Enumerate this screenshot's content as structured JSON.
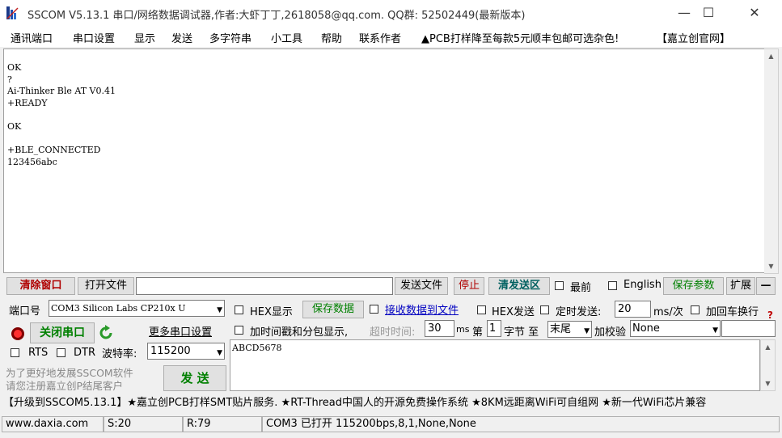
{
  "window": {
    "title": "SSCOM V5.13.1 串口/网络数据调试器,作者:大虾丁丁,2618058@qq.com. QQ群: 52502449(最新版本)",
    "minimize": "—",
    "maximize": "☐",
    "close": "✕"
  },
  "menu": [
    "通讯端口",
    "串口设置",
    "显示",
    "发送",
    "多字符串",
    "小工具",
    "帮助",
    "联系作者",
    "▲PCB打样降至每款5元顺丰包邮可选杂色!",
    "【嘉立创官网】"
  ],
  "receive": {
    "lines": [
      "OK",
      "?",
      "Ai-Thinker Ble AT V0.41",
      "+READY",
      "",
      "OK",
      "",
      "+BLE_CONNECTED",
      "123456abc"
    ]
  },
  "row1": {
    "clear_window": "清除窗口",
    "open_file": "打开文件",
    "file_path": "",
    "send_file": "发送文件",
    "stop": "停止",
    "clear_send": "清发送区",
    "last_checkbox": "最前",
    "english_checkbox": "English",
    "save_params": "保存参数",
    "expand": "扩展",
    "collapse": "—"
  },
  "port": {
    "port_label": "端口号",
    "port_value": "COM3 Silicon Labs CP210x U",
    "close_port": "关闭串口",
    "more_settings": "更多串口设置",
    "rts": "RTS",
    "dtr": "DTR",
    "baud_label": "波特率:",
    "baud_value": "115200",
    "promo_line1": "为了更好地发展SSCOM软件",
    "promo_line2": "请您注册嘉立创P结尾客户",
    "send_button": "发 送"
  },
  "options": {
    "hex_display": "HEX显示",
    "save_data": "保存数据",
    "recv_to_file": "接收数据到文件",
    "hex_send": "HEX发送",
    "timed_send": "定时发送:",
    "timed_value": "20",
    "timed_unit": "ms/次",
    "add_crlf": "加回车换行",
    "timestamp": "加时间戳和分包显示,",
    "timeout_label": "超时时间:",
    "timeout_value": "30",
    "timeout_unit": "ms",
    "byte_prefix": "第",
    "byte_index": "1",
    "byte_unit": "字节 至",
    "byte_end": "末尾",
    "checksum_label": "加校验",
    "checksum_value": "None",
    "help_mark": "?"
  },
  "send_area": {
    "text": "ABCD5678"
  },
  "ticker": "【升级到SSCOM5.13.1】★嘉立创PCB打样SMT贴片服务. ★RT-Thread中国人的开源免费操作系统 ★8KM远距离WiFi可自组网 ★新一代WiFi芯片兼容",
  "status": {
    "website": "www.daxia.com",
    "sent": "S:20",
    "received": "R:79",
    "port_status": "COM3 已打开  115200bps,8,1,None,None"
  },
  "colors": {
    "window_bg": "#f0f0f0",
    "green_text": "#008000",
    "red_text": "#b00000",
    "link_blue": "#0000c0"
  }
}
